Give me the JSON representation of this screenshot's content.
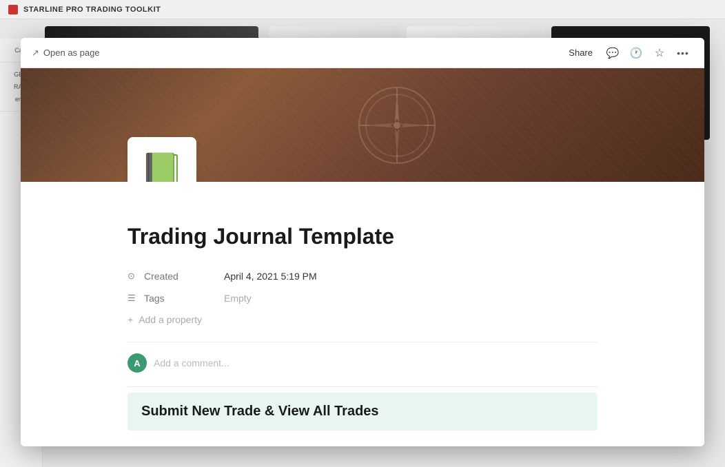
{
  "app": {
    "title": "STARLINE PRO TRADING TOOLKIT"
  },
  "sidebar": {
    "items": [
      {
        "label": "Cale"
      },
      {
        "label": "GEM"
      },
      {
        "label": "RADl"
      },
      {
        "label": "ente"
      }
    ]
  },
  "modal": {
    "toolbar": {
      "open_as_page_label": "Open as page",
      "share_label": "Share",
      "comment_icon": "💬",
      "history_icon": "🕐",
      "star_icon": "☆",
      "more_icon": "..."
    },
    "page": {
      "icon": "📗",
      "title": "Trading Journal Template",
      "properties": {
        "created_label": "Created",
        "created_value": "April 4, 2021 5:19 PM",
        "tags_label": "Tags",
        "tags_value": "Empty",
        "add_property_label": "Add a property"
      },
      "comment": {
        "avatar_letter": "A",
        "placeholder": "Add a comment..."
      },
      "content_block": {
        "title": "Submit New Trade & View All Trades"
      }
    }
  },
  "icons": {
    "open_page": "↗",
    "clock": "⊙",
    "list": "☰",
    "plus": "+",
    "comment": "💬",
    "history": "⏱",
    "star": "☆",
    "more": "•••"
  }
}
